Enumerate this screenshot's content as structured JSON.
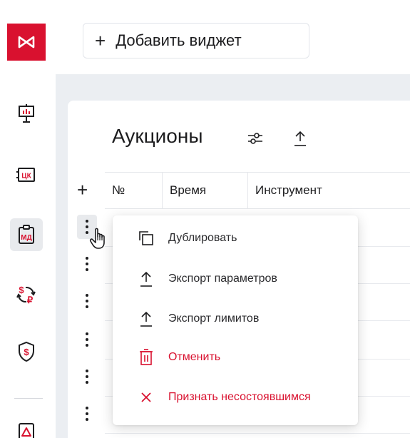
{
  "sidebar": {
    "logo_icon": "moex-logo-icon",
    "items": [
      {
        "icon": "presentation-chart-icon"
      },
      {
        "icon": "currency-badge-icon",
        "badge": "ЦК"
      },
      {
        "icon": "clipboard-badge-icon",
        "badge": "МД",
        "active": true
      },
      {
        "icon": "currency-exchange-icon"
      },
      {
        "icon": "shield-dollar-icon"
      },
      {
        "icon": "warning-document-icon"
      }
    ]
  },
  "topbar": {
    "add_widget_plus": "+",
    "add_widget_label": "Добавить виджет"
  },
  "panel": {
    "title": "Аукционы",
    "settings_icon": "sliders-icon",
    "export_icon": "upload-icon",
    "add_row_symbol": "+",
    "columns": [
      "№",
      "Время",
      "Инструмент"
    ],
    "row_count": 6
  },
  "context_menu": {
    "items": [
      {
        "label": "Дублировать",
        "icon": "duplicate-icon",
        "danger": false
      },
      {
        "label": "Экспорт параметров",
        "icon": "upload-icon",
        "danger": false
      },
      {
        "label": "Экспорт лимитов",
        "icon": "upload-icon",
        "danger": false
      },
      {
        "label": "Отменить",
        "icon": "trash-icon",
        "danger": true
      },
      {
        "label": "Признать несостоявшимся",
        "icon": "close-icon",
        "danger": true
      }
    ]
  },
  "colors": {
    "brand": "#d9112f",
    "danger": "#d9112f",
    "background": "#ebeef2",
    "active_bg": "#e8eaed"
  }
}
